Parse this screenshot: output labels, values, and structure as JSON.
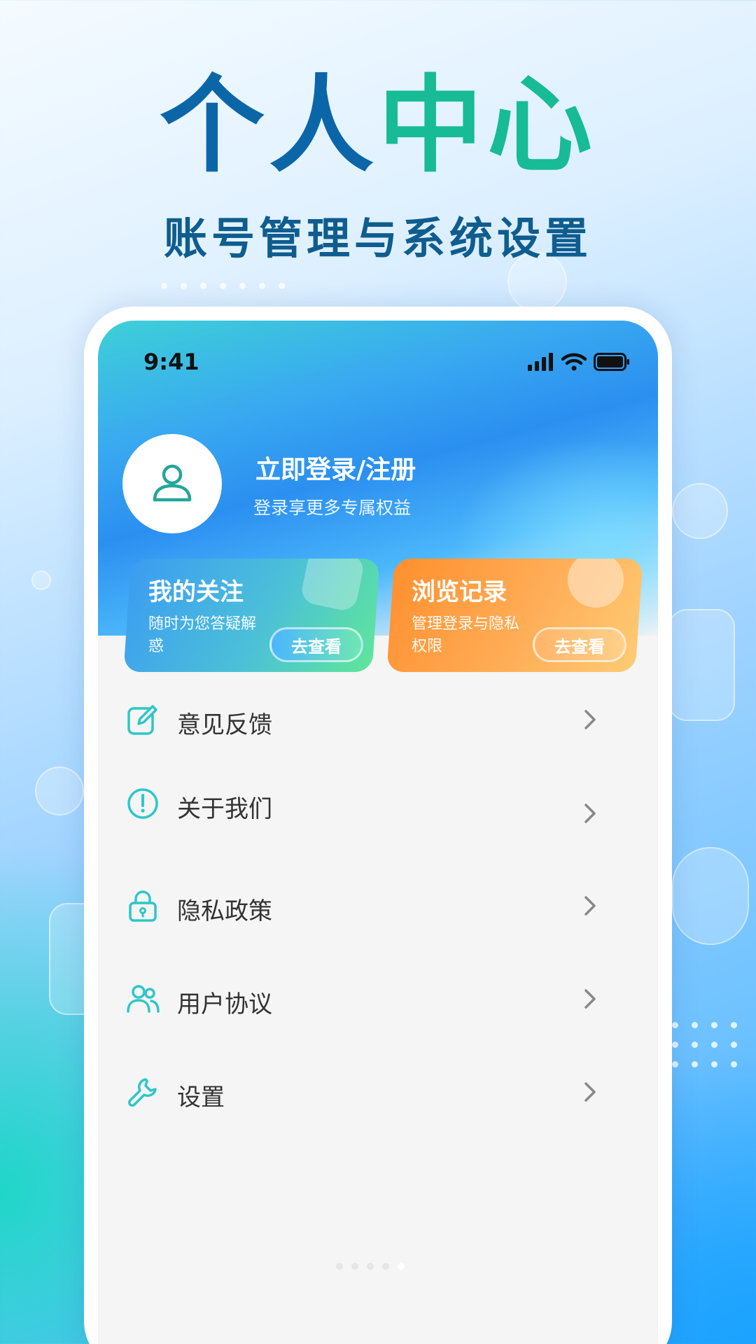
{
  "promo": {
    "title_part1": "个人",
    "title_part2": "中心",
    "subtitle": "账号管理与系统设置"
  },
  "status_bar": {
    "time": "9:41",
    "icons": [
      "signal-icon",
      "wifi-icon",
      "battery-icon"
    ]
  },
  "profile": {
    "avatar_icon": "user-icon",
    "login_label": "立即登录/注册",
    "login_subtitle": "登录享更多专属权益"
  },
  "cards": [
    {
      "title": "我的关注",
      "description": "随时为您答疑解惑",
      "button_label": "去查看",
      "accent": "#3b9cf2"
    },
    {
      "title": "浏览记录",
      "description": "管理登录与隐私权限",
      "button_label": "去查看",
      "accent": "#ff8f2e"
    }
  ],
  "menu": {
    "items": [
      {
        "label": "意见反馈",
        "icon": "edit-icon"
      },
      {
        "label": "关于我们",
        "icon": "info-icon"
      },
      {
        "label": "隐私政策",
        "icon": "lock-icon"
      },
      {
        "label": "用户协议",
        "icon": "users-icon"
      },
      {
        "label": "设置",
        "icon": "wrench-icon"
      }
    ],
    "icon_color": "#2fc6c9",
    "arrow_color": "#888888"
  },
  "pagination": {
    "total": 5,
    "active": 5
  }
}
